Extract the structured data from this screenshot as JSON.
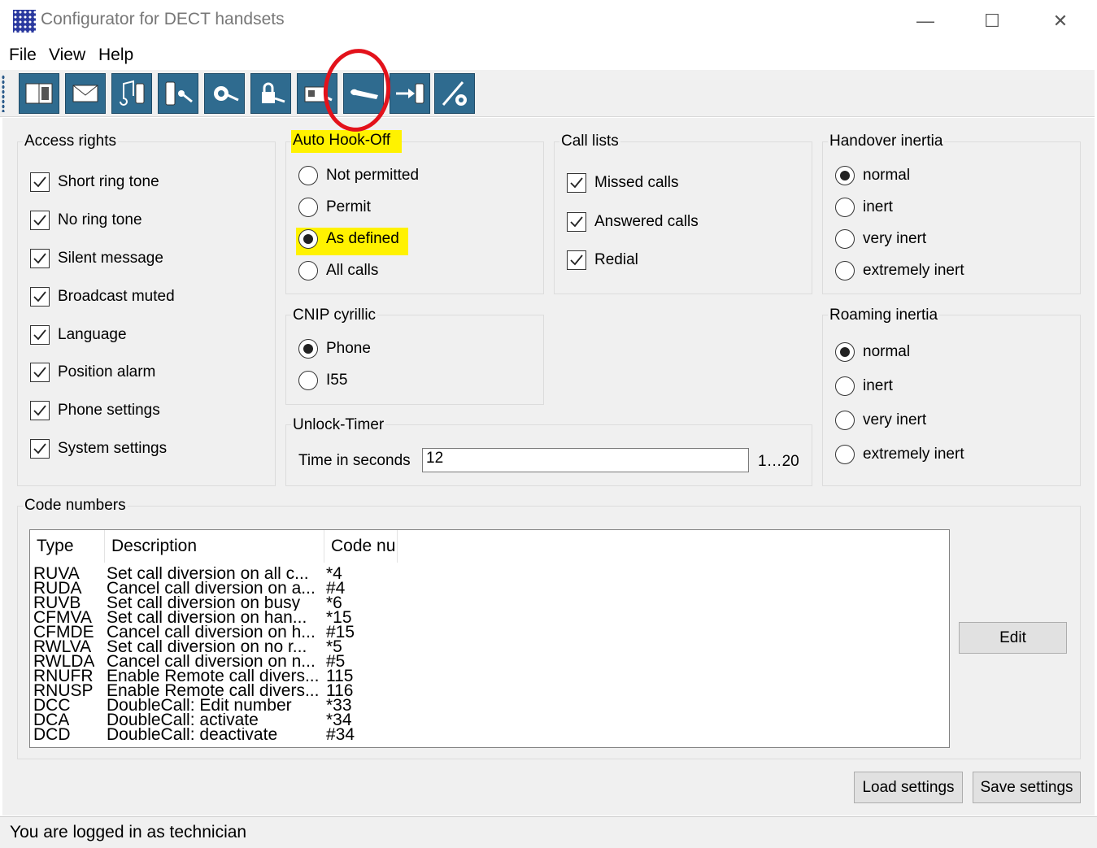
{
  "window": {
    "title": "Configurator for DECT handsets",
    "minimize_glyph": "—",
    "maximize_glyph": "☐",
    "close_glyph": "✕"
  },
  "menu": [
    "File",
    "View",
    "Help"
  ],
  "toolbar": {
    "icons": [
      "handset-book-icon",
      "envelope-icon",
      "music-phone-icon",
      "phone-key-icon",
      "phone-gear-icon",
      "lock-icon",
      "card-reader-icon",
      "wrench-icon",
      "transfer-phone-icon",
      "pen-gear-icon"
    ]
  },
  "access_rights": {
    "title": "Access rights",
    "items": [
      {
        "label": "Short ring tone",
        "checked": true
      },
      {
        "label": "No ring tone",
        "checked": true
      },
      {
        "label": "Silent message",
        "checked": true
      },
      {
        "label": "Broadcast muted",
        "checked": true
      },
      {
        "label": "Language",
        "checked": true
      },
      {
        "label": "Position alarm",
        "checked": true
      },
      {
        "label": "Phone settings",
        "checked": true
      },
      {
        "label": "System settings",
        "checked": true
      }
    ]
  },
  "auto_hook_off": {
    "title": "Auto Hook-Off",
    "options": [
      "Not permitted",
      "Permit",
      "As defined",
      "All calls"
    ],
    "selected": "As defined"
  },
  "call_lists": {
    "title": "Call lists",
    "items": [
      {
        "label": "Missed calls",
        "checked": true
      },
      {
        "label": "Answered calls",
        "checked": true
      },
      {
        "label": "Redial",
        "checked": true
      }
    ]
  },
  "handover_inertia": {
    "title": "Handover inertia",
    "options": [
      "normal",
      "inert",
      "very inert",
      "extremely inert"
    ],
    "selected": "normal"
  },
  "cnip": {
    "title": "CNIP  cyrillic",
    "options": [
      "Phone",
      "I55"
    ],
    "selected": "Phone"
  },
  "unlock_timer": {
    "title": "Unlock-Timer",
    "label": "Time in seconds",
    "value": "12",
    "range": "1…20"
  },
  "roaming_inertia": {
    "title": "Roaming inertia",
    "options": [
      "normal",
      "inert",
      "very inert",
      "extremely inert"
    ],
    "selected": "normal"
  },
  "code_numbers": {
    "title": "Code numbers",
    "columns": [
      "Type",
      "Description",
      "Code nu"
    ],
    "rows": [
      [
        "RUVA",
        "Set call diversion on all c...",
        "*4"
      ],
      [
        "RUDA",
        "Cancel call diversion on a...",
        "#4"
      ],
      [
        "RUVB",
        "Set call diversion on busy",
        "*6"
      ],
      [
        "CFMVA",
        "Set call diversion on han...",
        "*15"
      ],
      [
        "CFMDE",
        "Cancel call diversion on h...",
        "#15"
      ],
      [
        "RWLVA",
        "Set call diversion on no r...",
        "*5"
      ],
      [
        "RWLDA",
        "Cancel call diversion on n...",
        "#5"
      ],
      [
        "RNUFR",
        "Enable Remote call divers...",
        "115"
      ],
      [
        "RNUSP",
        "Enable Remote call divers...",
        "116"
      ],
      [
        "DCC",
        "DoubleCall: Edit number",
        "*33"
      ],
      [
        "DCA",
        "DoubleCall: activate",
        "*34"
      ],
      [
        "DCD",
        "DoubleCall: deactivate",
        "#34"
      ]
    ],
    "edit_label": "Edit"
  },
  "buttons": {
    "load": "Load settings",
    "save": "Save settings"
  },
  "status": "You are logged in as technician",
  "colors": {
    "highlight": "#fff200",
    "annotation_circle": "#e3121b",
    "toolbar_button": "#2f6b8f"
  }
}
